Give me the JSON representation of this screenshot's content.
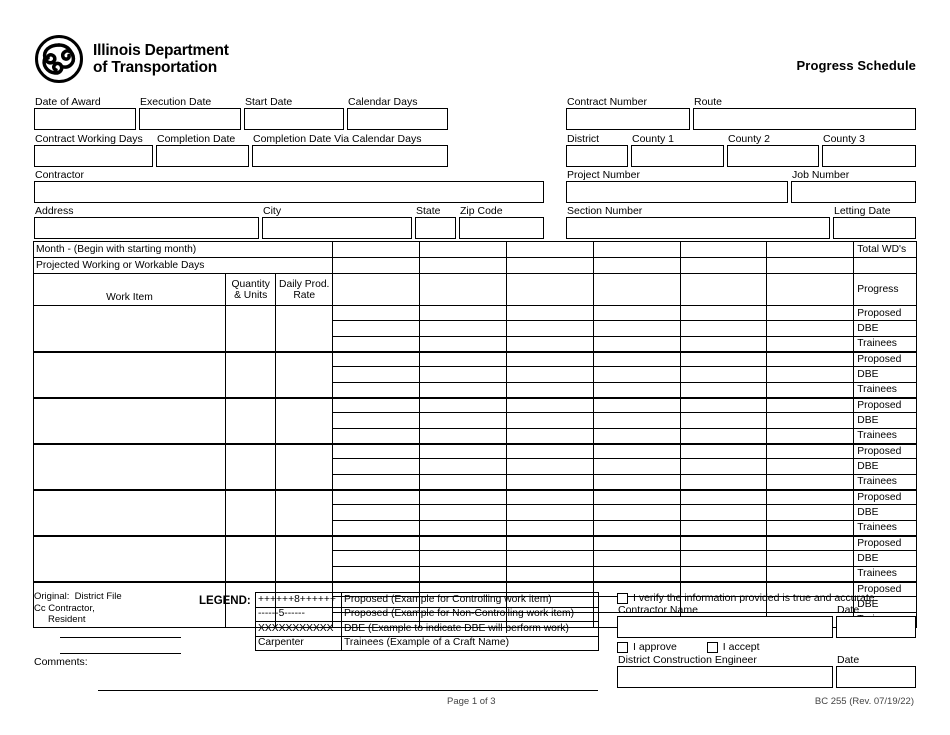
{
  "header": {
    "agency_name": "Illinois Department\nof Transportation",
    "logo_icon": "idot-trillium-logo",
    "title": "Progress Schedule"
  },
  "left_fields": {
    "row1": [
      {
        "label": "Date of Award",
        "value": ""
      },
      {
        "label": "Execution Date",
        "value": ""
      },
      {
        "label": "Start Date",
        "value": ""
      },
      {
        "label": "Calendar Days",
        "value": ""
      }
    ],
    "row2": [
      {
        "label": "Contract Working Days",
        "value": ""
      },
      {
        "label": "Completion Date",
        "value": ""
      },
      {
        "label": "Completion Date Via Calendar Days",
        "value": ""
      }
    ],
    "row3": [
      {
        "label": "Contractor",
        "value": ""
      }
    ],
    "row4": [
      {
        "label": "Address",
        "value": ""
      },
      {
        "label": "City",
        "value": ""
      },
      {
        "label": "State",
        "value": ""
      },
      {
        "label": "Zip Code",
        "value": ""
      }
    ]
  },
  "right_fields": {
    "row1": [
      {
        "label": "Contract Number",
        "value": ""
      },
      {
        "label": "Route",
        "value": ""
      }
    ],
    "row2": [
      {
        "label": "District",
        "value": ""
      },
      {
        "label": "County 1",
        "value": ""
      },
      {
        "label": "County 2",
        "value": ""
      },
      {
        "label": "County 3",
        "value": ""
      }
    ],
    "row3": [
      {
        "label": "Project Number",
        "value": ""
      },
      {
        "label": "Job Number",
        "value": ""
      }
    ],
    "row4": [
      {
        "label": "Section Number",
        "value": ""
      },
      {
        "label": "Letting Date",
        "value": ""
      }
    ]
  },
  "schedule_table": {
    "month_row_label": "Month - (Begin with starting month)",
    "working_days_row_label": "Projected Working or Workable Days",
    "col_work_item": "Work Item",
    "col_quantity_units": "Quantity\n& Units",
    "col_daily_prod_rate": "Daily Prod.\nRate",
    "col_total_wds": "Total WD's",
    "col_progress": "Progress",
    "month_columns": [
      "",
      "",
      "",
      "",
      "",
      ""
    ],
    "month_values": [
      "",
      "",
      "",
      "",
      "",
      ""
    ],
    "working_days_values": [
      "",
      "",
      "",
      "",
      "",
      ""
    ],
    "sub_row_labels": [
      "Proposed",
      "DBE",
      "Trainees"
    ],
    "work_item_rows": [
      {
        "work_item": "",
        "quantity_units": "",
        "daily_prod_rate": ""
      },
      {
        "work_item": "",
        "quantity_units": "",
        "daily_prod_rate": ""
      },
      {
        "work_item": "",
        "quantity_units": "",
        "daily_prod_rate": ""
      },
      {
        "work_item": "",
        "quantity_units": "",
        "daily_prod_rate": ""
      },
      {
        "work_item": "",
        "quantity_units": "",
        "daily_prod_rate": ""
      },
      {
        "work_item": "",
        "quantity_units": "",
        "daily_prod_rate": ""
      },
      {
        "work_item": "",
        "quantity_units": "",
        "daily_prod_rate": ""
      }
    ]
  },
  "legend": {
    "title": "LEGEND:",
    "rows": [
      {
        "symbol": "++++++8++++++",
        "description": "Proposed (Example for Controlling work item)"
      },
      {
        "symbol": "------5------",
        "description": "Proposed (Example for Non-Controlling work item)"
      },
      {
        "symbol": "XXXXXXXXXXX",
        "description": "DBE (Example to indicate DBE will perform work)"
      },
      {
        "symbol": "Carpenter",
        "description": "Trainees (Example of a Craft Name)"
      }
    ]
  },
  "distribution": {
    "original_label": "Original:",
    "original_value": "District File",
    "cc_label": "Cc",
    "cc_line1": "Contractor,",
    "cc_line2": "Resident"
  },
  "comments": {
    "label": "Comments:",
    "value": ""
  },
  "signature": {
    "verify_checkbox_label": "I verify the information provided is true and accurate.",
    "contractor_name_label": "Contractor Name",
    "contractor_name_value": "",
    "contractor_date_label": "Date",
    "contractor_date_value": "",
    "approve_checkbox_label": "I approve",
    "accept_checkbox_label": "I accept",
    "engineer_label": "District Construction Engineer",
    "engineer_value": "",
    "engineer_date_label": "Date",
    "engineer_date_value": ""
  },
  "footer": {
    "page": "Page 1 of 3",
    "form_number": "BC 255 (Rev. 07/19/22)"
  }
}
